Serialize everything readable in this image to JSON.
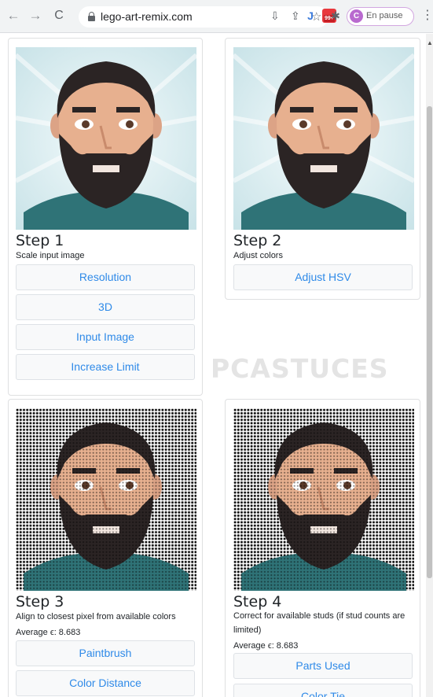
{
  "browser": {
    "back_glyph": "←",
    "forward_glyph": "→",
    "reload_glyph": "C",
    "url": "lego-art-remix.com",
    "install_glyph": "⇩",
    "share_glyph": "⇪",
    "star_glyph": "☆",
    "extension_jm_glyph": "J",
    "extension_pdf_badge": "99+",
    "extensions_glyph": "✱",
    "profile_initial": "C",
    "profile_label": "En pause",
    "menu_glyph": "⋮",
    "scroll_up_glyph": "▲"
  },
  "watermark": "PCASTUCES",
  "steps": [
    {
      "title": "Step 1",
      "description": "Scale input image",
      "buttons": [
        "Resolution",
        "3D",
        "Input Image",
        "Increase Limit"
      ]
    },
    {
      "title": "Step 2",
      "description": "Adjust colors",
      "buttons": [
        "Adjust HSV"
      ]
    },
    {
      "title": "Step 3",
      "description": "Align to closest pixel from available colors",
      "average": "Average ϵ: 8.683",
      "buttons": [
        "Paintbrush",
        "Color Distance"
      ]
    },
    {
      "title": "Step 4",
      "description_line1": "Correct for available studs (if stud counts are",
      "description_line2": "limited)",
      "average": "Average ϵ: 8.683",
      "buttons": [
        "Parts Used",
        "Color Tie"
      ]
    }
  ],
  "colors": {
    "accent": "#2f8ae8",
    "skin": "#e7b08f",
    "hair": "#2b2424",
    "shirt": "#2f7377",
    "background_rays": "#d8ecef"
  }
}
